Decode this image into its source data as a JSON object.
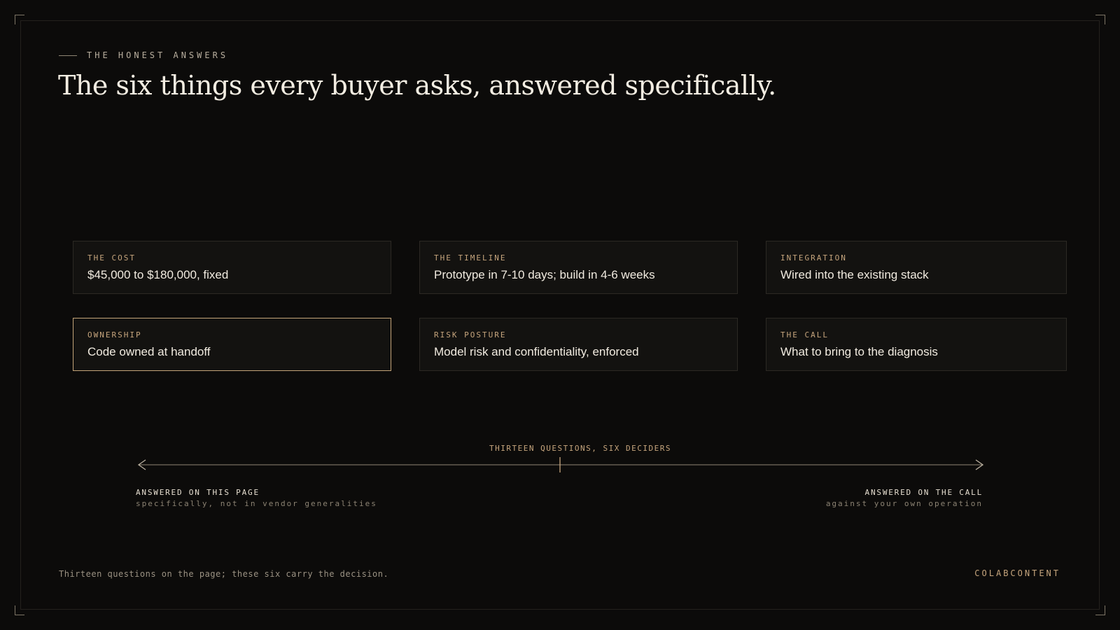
{
  "header": {
    "eyebrow": "THE HONEST ANSWERS",
    "title": "The six things every buyer asks, answered specifically."
  },
  "cards": [
    {
      "label": "THE COST",
      "value": "$45,000 to $180,000, fixed",
      "active": false
    },
    {
      "label": "THE TIMELINE",
      "value": "Prototype in 7-10 days; build in 4-6 weeks",
      "active": false
    },
    {
      "label": "INTEGRATION",
      "value": "Wired into the existing stack",
      "active": false
    },
    {
      "label": "OWNERSHIP",
      "value": "Code owned at handoff",
      "active": true
    },
    {
      "label": "RISK POSTURE",
      "value": "Model risk and confidentiality, enforced",
      "active": false
    },
    {
      "label": "THE CALL",
      "value": "What to bring to the diagnosis",
      "active": false
    }
  ],
  "axis": {
    "title": "THIRTEEN QUESTIONS, SIX DECIDERS",
    "left": {
      "title": "ANSWERED ON THIS PAGE",
      "subtitle": "specifically, not in vendor generalities"
    },
    "right": {
      "title": "ANSWERED ON THE CALL",
      "subtitle": "against your own operation"
    }
  },
  "footer": {
    "note": "Thirteen questions on the page; these six carry the decision.",
    "brand": "COLABCONTENT"
  },
  "colors": {
    "background": "#0c0b0a",
    "accent": "#c6a57d",
    "active_border": "#c3a478",
    "card_border": "#2c2924"
  }
}
